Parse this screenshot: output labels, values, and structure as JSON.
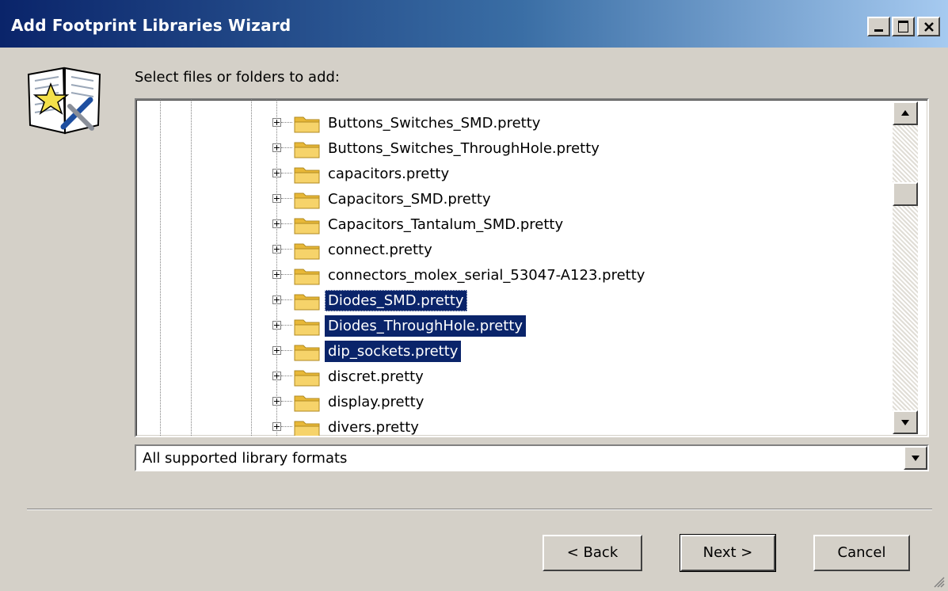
{
  "window": {
    "title": "Add Footprint Libraries Wizard",
    "controls": [
      "minimize",
      "maximize",
      "close"
    ]
  },
  "wizard": {
    "icon": "wizard-book-icon",
    "prompt": "Select files or folders to add:"
  },
  "tree": {
    "items": [
      {
        "label": "Buttons_Switches_SMD.pretty",
        "selected": false
      },
      {
        "label": "Buttons_Switches_ThroughHole.pretty",
        "selected": false
      },
      {
        "label": "capacitors.pretty",
        "selected": false
      },
      {
        "label": "Capacitors_SMD.pretty",
        "selected": false
      },
      {
        "label": "Capacitors_Tantalum_SMD.pretty",
        "selected": false
      },
      {
        "label": "connect.pretty",
        "selected": false
      },
      {
        "label": "connectors_molex_serial_53047-A123.pretty",
        "selected": false
      },
      {
        "label": "Diodes_SMD.pretty",
        "selected": true,
        "focused": true
      },
      {
        "label": "Diodes_ThroughHole.pretty",
        "selected": true
      },
      {
        "label": "dip_sockets.pretty",
        "selected": true
      },
      {
        "label": "discret.pretty",
        "selected": false
      },
      {
        "label": "display.pretty",
        "selected": false
      },
      {
        "label": "divers.pretty",
        "selected": false
      }
    ]
  },
  "filter": {
    "value": "All supported library formats"
  },
  "buttons": {
    "back": "< Back",
    "next": "Next >",
    "cancel": "Cancel"
  },
  "colors": {
    "selection": "#0a246a",
    "face": "#d4d0c8",
    "folder": "#e8b838"
  }
}
